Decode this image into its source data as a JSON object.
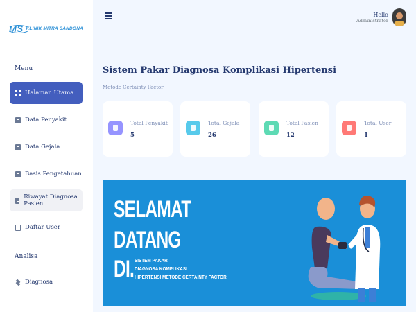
{
  "brand": {
    "mark": "MS",
    "name": "KLINIK MITRA SANDONA"
  },
  "sidebar": {
    "sections": [
      {
        "title": "Menu"
      },
      {
        "title": "Analisa"
      }
    ],
    "items": [
      {
        "label": "Halaman Utama",
        "icon": "grid-icon"
      },
      {
        "label": "Data Penyakit",
        "icon": "document-icon"
      },
      {
        "label": "Data Gejala",
        "icon": "document-icon"
      },
      {
        "label": "Basis Pengetahuan",
        "icon": "document-icon"
      },
      {
        "label": "Riwayat Diagnosa Pasien",
        "icon": "document-icon"
      },
      {
        "label": "Daftar User",
        "icon": "user-file-icon"
      },
      {
        "label": "Diagnosa",
        "icon": "layers-icon"
      }
    ]
  },
  "header": {
    "hello": "Hello",
    "role": "Administrator"
  },
  "page": {
    "title": "Sistem Pakar Diagnosa Komplikasi Hipertensi",
    "subtitle": "Metode Certainty Factor"
  },
  "stats": [
    {
      "label": "Total Penyakit",
      "value": "5",
      "color": "#9694ff",
      "icon": "virus-icon"
    },
    {
      "label": "Total Gejala",
      "value": "26",
      "color": "#57caeb",
      "icon": "bookmark-icon"
    },
    {
      "label": "Total Pasien",
      "value": "12",
      "color": "#5ddab4",
      "icon": "patient-icon"
    },
    {
      "label": "Total User",
      "value": "1",
      "color": "#ff7976",
      "icon": "user-icon"
    }
  ],
  "banner": {
    "line1": "SELAMAT",
    "line2": "DATANG",
    "line3": "DI.",
    "sub1": "SISTEM PAKAR",
    "sub2": "DIAGNOSA KOMPLIKASI",
    "sub3": "HIPERTENSI METODE CERTAINTY FACTOR",
    "background": "#1a8fd8"
  },
  "colors": {
    "accent": "#435ebe",
    "background": "#f2f7ff",
    "text": "#25396f"
  }
}
